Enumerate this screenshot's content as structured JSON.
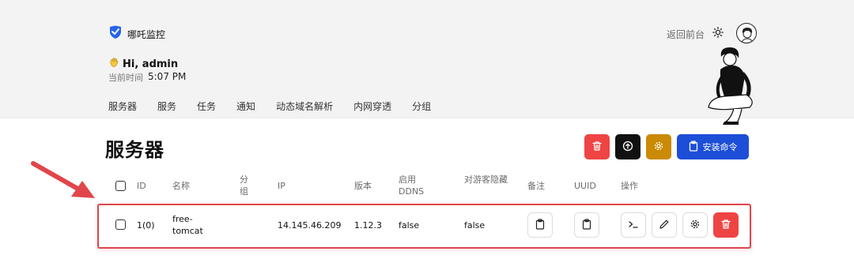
{
  "header": {
    "brand": "哪吒监控",
    "back_link": "返回前台",
    "greeting": "Hi, admin",
    "time_label": "当前时间",
    "time_value": "5:07 PM",
    "nav": [
      "服务器",
      "服务",
      "任务",
      "通知",
      "动态域名解析",
      "内网穿透",
      "分组"
    ]
  },
  "page": {
    "title": "服务器",
    "install_label": "安装命令"
  },
  "table": {
    "columns": [
      "ID",
      "名称",
      "分组",
      "IP",
      "版本",
      "启用 DDNS",
      "对游客隐藏",
      "备注",
      "UUID",
      "操作"
    ],
    "rows": [
      {
        "id": "1(0)",
        "name": "free-tomcat",
        "group": "",
        "ip": "14.145.46.209",
        "version": "1.12.3",
        "ddns": "false",
        "hidden": "false"
      }
    ]
  },
  "colors": {
    "danger": "#ef4444",
    "dark": "#111111",
    "warning": "#ca8a04",
    "primary": "#1d4ed8",
    "highlight": "#e0464b"
  },
  "icons": [
    "shield-logo-icon",
    "sun-icon",
    "avatar",
    "waving-hand-icon",
    "trash-icon",
    "upload-icon",
    "settings-icon",
    "clipboard-icon",
    "terminal-icon",
    "pencil-icon",
    "arrow-annotation"
  ]
}
